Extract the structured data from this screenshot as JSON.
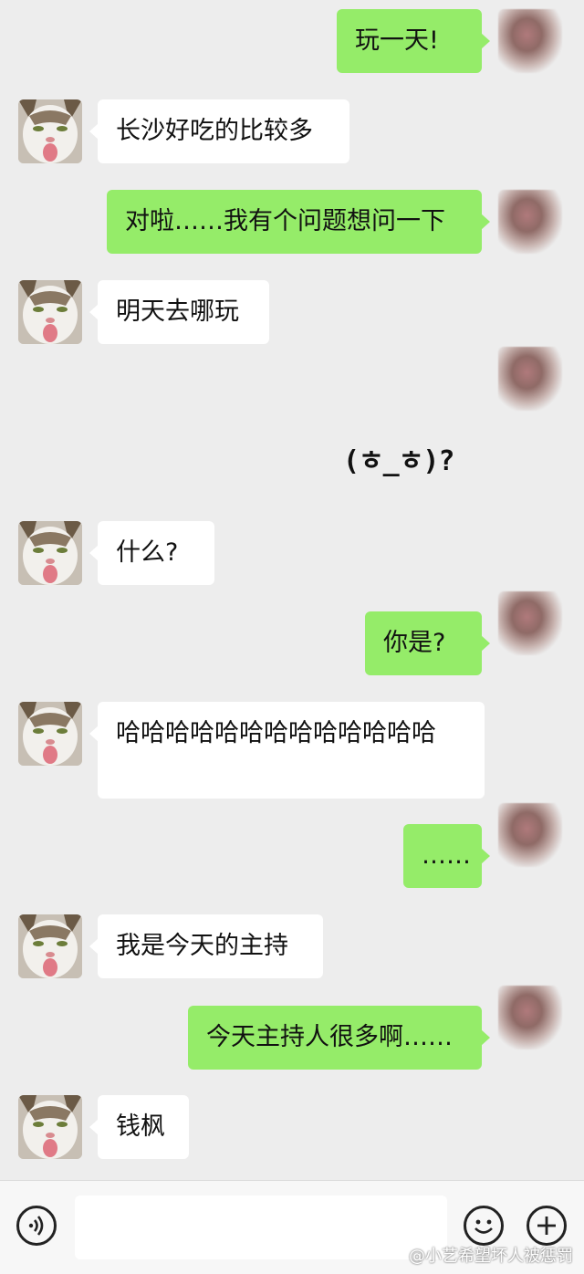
{
  "messages": [
    {
      "side": "out",
      "text": "玩一天!"
    },
    {
      "side": "in",
      "text": "长沙好吃的比较多"
    },
    {
      "side": "out",
      "text": "对啦……我有个问题想问一下"
    },
    {
      "side": "in",
      "text": "明天去哪玩"
    },
    {
      "side": "out",
      "sticker": "(ㅎ_ㅎ)?"
    },
    {
      "side": "in",
      "text": "什么?"
    },
    {
      "side": "out",
      "text": "你是?"
    },
    {
      "side": "in",
      "text": "哈哈哈哈哈哈哈哈哈哈哈哈哈"
    },
    {
      "side": "out",
      "text": "……"
    },
    {
      "side": "in",
      "text": "我是今天的主持"
    },
    {
      "side": "out",
      "text": "今天主持人很多啊……"
    },
    {
      "side": "in",
      "text": "钱枫"
    }
  ],
  "input_bar": {
    "voice_icon": "voice-icon",
    "emoji_icon": "emoji-icon",
    "plus_icon": "plus-icon"
  },
  "watermark": "@小艺希望坏人被惩罚",
  "colors": {
    "background": "#ededed",
    "bubble_out": "#95ec69",
    "bubble_in": "#ffffff"
  }
}
